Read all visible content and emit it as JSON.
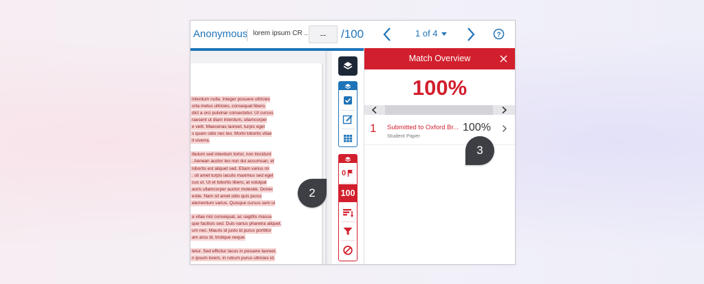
{
  "header": {
    "student_name": "Anonymous",
    "assignment_title": "lorem ipsum CR ...",
    "grade_value": "--",
    "grade_max": "/100",
    "student_position": "1 of 4"
  },
  "document": {
    "lines": [
      "interdum nulla. Integer posuere ultricies",
      "orta metus ultricies, consequat libero.",
      "dict a orci pulvinar consectetur. Ut cursus",
      "raesent ut diam interdum, ullamcorper",
      "e velit. Maecenas laoreet, turpis eget",
      "s quam odio nec leo. Morbi lobortis vitae",
      "it viverra.",
      "",
      "ibulum sed interdum tortor, non tincidunt",
      ". Aenean auctor leo non dui accumsan, et",
      "lobortis est aliquet sed. Etiam varius mi",
      ". sit amet turpis iaculis maximus sed eget",
      "cus ut. Ut et lobortis libero, at volutpat",
      "auris ullamcorper auctor molestie. Donec",
      "estie. Nam sit amet odio quis purus",
      "elementum varius. Quisque cursus sem ut",
      "",
      "a vitae nisl consequat, ac sagittis massa",
      "que facilisis sed. Duis varius pharetra aliquet.",
      "um nec. Mauris id justo id purus porttitor",
      "am arcu id, tristique neque.",
      "",
      "tetur. Sed efficitur lacus in posuere laoreet.",
      "n ipsum lorem, in rutrum purus ultricies id."
    ]
  },
  "toolbar": {
    "flags_count": "0",
    "similarity_score": "100"
  },
  "match_overview": {
    "title": "Match Overview",
    "overall_score": "100%",
    "matches": [
      {
        "number": "1",
        "source": "Submitted to Oxford Br...",
        "type": "Student Paper",
        "percent": "100%"
      }
    ]
  },
  "callouts": {
    "toolbar_callout": "2",
    "match_callout": "3"
  },
  "colors": {
    "accent_blue": "#1f74b8",
    "similarity_red": "#d21f2d",
    "dark_button": "#1d2837",
    "callout_gray": "#3d3f44"
  },
  "icons": [
    "layers-icon",
    "check-icon",
    "edit-icon",
    "grid-icon",
    "flag-icon",
    "sort-icon",
    "filter-icon",
    "exclude-icon",
    "close-icon",
    "help-icon",
    "chevron-left-icon",
    "chevron-right-icon",
    "caret-down-icon"
  ]
}
